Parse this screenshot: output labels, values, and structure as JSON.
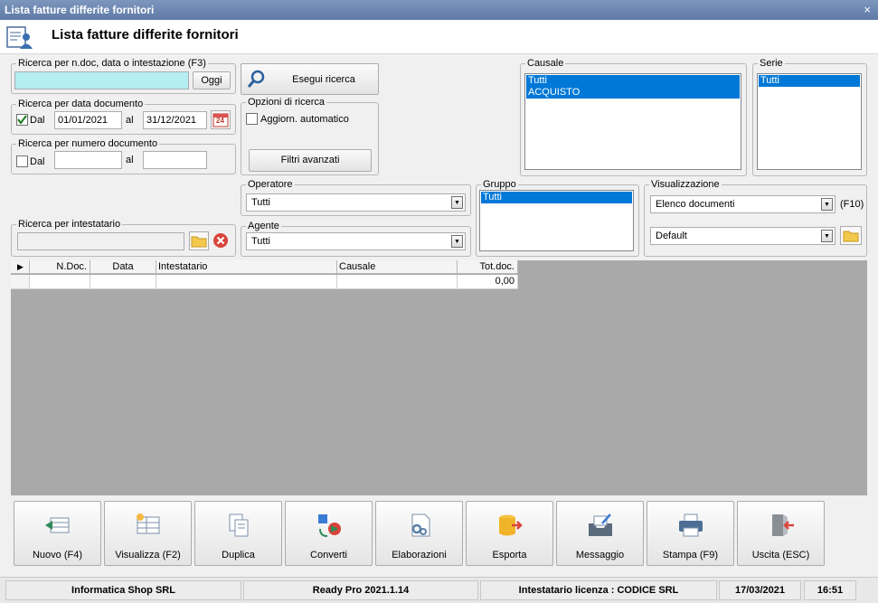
{
  "window": {
    "title": "Lista fatture differite fornitori",
    "close": "×"
  },
  "page": {
    "title": "Lista fatture differite fornitori"
  },
  "search_text": {
    "legend": "Ricerca per n.doc, data o intestazione (F3)",
    "value": "",
    "oggi_label": "Oggi"
  },
  "search_button": {
    "label": "Esegui ricerca"
  },
  "date_search": {
    "legend": "Ricerca per data documento",
    "checked": true,
    "from_label": "Dal",
    "from": "01/01/2021",
    "to_label": "al",
    "to": "31/12/2021",
    "calendar_day": "24"
  },
  "options": {
    "legend": "Opzioni di ricerca",
    "auto_label": "Aggiorn. automatico",
    "auto_checked": false,
    "advanced_label": "Filtri avanzati"
  },
  "number_search": {
    "legend": "Ricerca per numero documento",
    "checked": false,
    "from_label": "Dal",
    "from": "",
    "to_label": "al",
    "to": ""
  },
  "causale": {
    "legend": "Causale",
    "items": [
      "Tutti",
      "ACQUISTO"
    ]
  },
  "serie": {
    "legend": "Serie",
    "items": [
      "Tutti"
    ]
  },
  "operatore": {
    "legend": "Operatore",
    "value": "Tutti"
  },
  "agente": {
    "legend": "Agente",
    "value": "Tutti"
  },
  "gruppo": {
    "legend": "Gruppo",
    "items": [
      "Tutti"
    ]
  },
  "visualizzazione": {
    "legend": "Visualizzazione",
    "value": "Elenco documenti",
    "shortcut": "(F10)",
    "layout": "Default"
  },
  "intestatario": {
    "legend": "Ricerca per intestatario",
    "value": ""
  },
  "grid": {
    "columns": [
      "N.Doc.",
      "Data",
      "Intestatario",
      "Causale",
      "Tot.doc."
    ],
    "rows": [
      [
        "",
        "",
        "",
        "",
        "0,00"
      ]
    ]
  },
  "toolbar": {
    "buttons": [
      {
        "label": "Nuovo (F4)",
        "icon": "new-document-icon"
      },
      {
        "label": "Visualizza (F2)",
        "icon": "view-grid-icon"
      },
      {
        "label": "Duplica",
        "icon": "duplicate-icon"
      },
      {
        "label": "Converti",
        "icon": "convert-icon"
      },
      {
        "label": "Elaborazioni",
        "icon": "processing-icon"
      },
      {
        "label": "Esporta",
        "icon": "export-icon"
      },
      {
        "label": "Messaggio",
        "icon": "message-icon"
      },
      {
        "label": "Stampa (F9)",
        "icon": "printer-icon"
      },
      {
        "label": "Uscita (ESC)",
        "icon": "exit-icon"
      }
    ]
  },
  "status": {
    "company": "Informatica Shop SRL",
    "version": "Ready Pro 2021.1.14",
    "license": "Intestatario licenza : CODICE SRL",
    "date": "17/03/2021",
    "time": "16:51"
  },
  "colors": {
    "titlebar": "#6f88b2",
    "selection": "#0078d7",
    "search_field": "#b4eef2",
    "grid_bg": "#a9a9a9"
  }
}
